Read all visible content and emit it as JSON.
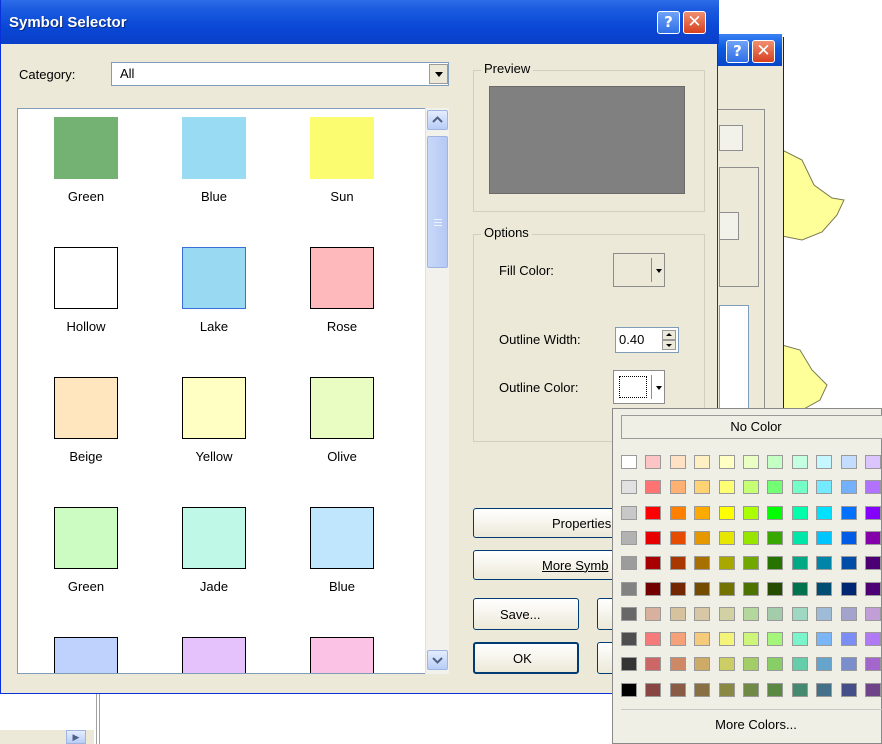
{
  "dialog": {
    "title": "Symbol Selector",
    "category_label": "Category:",
    "category_value": "All",
    "preview_label": "Preview",
    "options_label": "Options",
    "fill_color_label": "Fill Color:",
    "outline_width_label": "Outline Width:",
    "outline_width_value": "0.40",
    "outline_color_label": "Outline Color:",
    "properties_label": "Properties",
    "more_symbols_label": "More Symb",
    "save_label": "Save...",
    "ok_label": "OK"
  },
  "symbols": [
    {
      "label": "Green",
      "fill": "#73b273",
      "border": "#73b273"
    },
    {
      "label": "Blue",
      "fill": "#99dbf2",
      "border": "#99dbf2"
    },
    {
      "label": "Sun",
      "fill": "#fcfc70",
      "border": "#fcfc70"
    },
    {
      "label": "Hollow",
      "fill": "#ffffff",
      "border": "#000000"
    },
    {
      "label": "Lake",
      "fill": "#99d9f2",
      "border": "#3a6fd8"
    },
    {
      "label": "Rose",
      "fill": "#fdb9bb",
      "border": "#000000"
    },
    {
      "label": "Beige",
      "fill": "#ffe6bf",
      "border": "#000000"
    },
    {
      "label": "Yellow",
      "fill": "#ffffc3",
      "border": "#000000"
    },
    {
      "label": "Olive",
      "fill": "#e9fcc2",
      "border": "#000000"
    },
    {
      "label": "Green",
      "fill": "#ccfcc2",
      "border": "#000000"
    },
    {
      "label": "Jade",
      "fill": "#bff8e6",
      "border": "#000000"
    },
    {
      "label": "Blue",
      "fill": "#bfe6fd",
      "border": "#000000"
    },
    {
      "label": "",
      "fill": "#bfd2fd",
      "border": "#000000"
    },
    {
      "label": "",
      "fill": "#e6c2fd",
      "border": "#000000"
    },
    {
      "label": "",
      "fill": "#fcc2e6",
      "border": "#000000"
    }
  ],
  "palette": {
    "no_color_label": "No Color",
    "more_colors_label": "More Colors...",
    "rows": [
      [
        "#ffffff",
        "#fcc4c4",
        "#ffe1c4",
        "#fff0c4",
        "#ffffc4",
        "#eaffc4",
        "#c4ffc4",
        "#c4ffe1",
        "#c4f7ff",
        "#c4dcff",
        "#dcc4ff"
      ],
      [
        "#e1e1e1",
        "#ff7373",
        "#ffb173",
        "#ffd373",
        "#ffff73",
        "#c5ff73",
        "#73ff73",
        "#73ffc5",
        "#73eaff",
        "#73b1ff",
        "#b173ff"
      ],
      [
        "#c8c8c8",
        "#ff0000",
        "#ff7f00",
        "#ffaa00",
        "#ffff00",
        "#aaff00",
        "#00ff00",
        "#00ffaa",
        "#00e1ff",
        "#0070ff",
        "#8400ff"
      ],
      [
        "#b2b2b2",
        "#e60000",
        "#e64c00",
        "#e69800",
        "#e6e600",
        "#98e600",
        "#38a800",
        "#00e6a9",
        "#00c5ff",
        "#005ce6",
        "#8400a8"
      ],
      [
        "#9c9c9c",
        "#a80000",
        "#a83800",
        "#a87000",
        "#a8a800",
        "#70a800",
        "#267300",
        "#00a884",
        "#0084a8",
        "#004da8",
        "#4c0073"
      ],
      [
        "#828282",
        "#730000",
        "#732600",
        "#734c00",
        "#737300",
        "#4c7300",
        "#264c00",
        "#00734c",
        "#004c73",
        "#002673",
        "#4c0073"
      ],
      [
        "#686868",
        "#d7b09e",
        "#d7c29e",
        "#d7c7a4",
        "#d1d1a4",
        "#b4d79e",
        "#a3ccab",
        "#9ed7c2",
        "#9ebbd7",
        "#a3a3cc",
        "#c29ed7"
      ],
      [
        "#4e4e4e",
        "#f57a7a",
        "#f5a27a",
        "#f5ca7a",
        "#f4f47a",
        "#cdf57a",
        "#a5f57a",
        "#7af5ca",
        "#7ab6f5",
        "#7a8ef5",
        "#b07af5"
      ],
      [
        "#343434",
        "#cd6666",
        "#cd8966",
        "#cdaa66",
        "#cdcd66",
        "#a3cd66",
        "#89cd66",
        "#66cdab",
        "#66a3cd",
        "#7a8ecd",
        "#a366cd"
      ],
      [
        "#000000",
        "#894444",
        "#895a44",
        "#897044",
        "#898944",
        "#708944",
        "#5a8944",
        "#448970",
        "#447089",
        "#444f89",
        "#704489"
      ]
    ]
  }
}
